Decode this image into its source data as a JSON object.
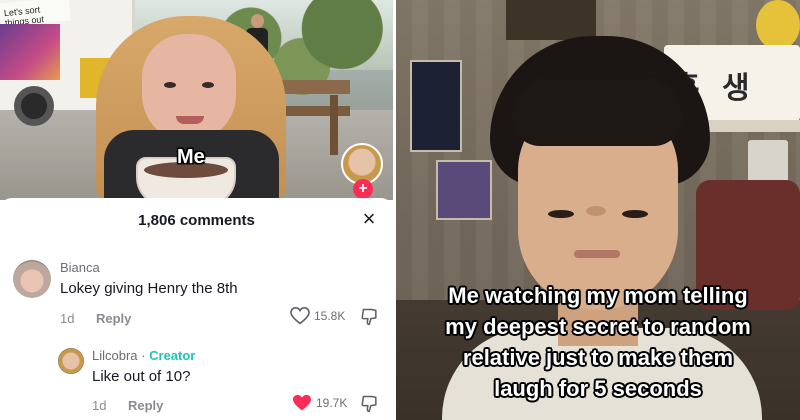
{
  "left_panel": {
    "truck_sign": "Let's sort things out",
    "photo_label": "Me",
    "comments_header": "1,806 comments",
    "close_glyph": "×",
    "comments": [
      {
        "username": "Bianca",
        "text": "Lokey giving Henry the 8th",
        "age": "1d",
        "reply_label": "Reply",
        "likes": "15.8K",
        "liked": false
      },
      {
        "username": "Lilcobra",
        "separator": "·",
        "creator_tag": "Creator",
        "text": "Like out of 10?",
        "age": "1d",
        "reply_label": "Reply",
        "likes": "19.7K",
        "liked": true
      }
    ],
    "colors": {
      "creator": "#20c4b7",
      "heart_liked": "#fe2c55",
      "follow_plus": "#fe2c55"
    },
    "icons": [
      "close-icon",
      "heart-icon",
      "dislike-icon",
      "plus-icon"
    ]
  },
  "right_panel": {
    "sign_text": "흠 생 일",
    "caption_lines": [
      "Me watching my mom telling",
      "my deepest secret to random",
      "relative just to make them",
      "laugh for 5 seconds"
    ]
  }
}
